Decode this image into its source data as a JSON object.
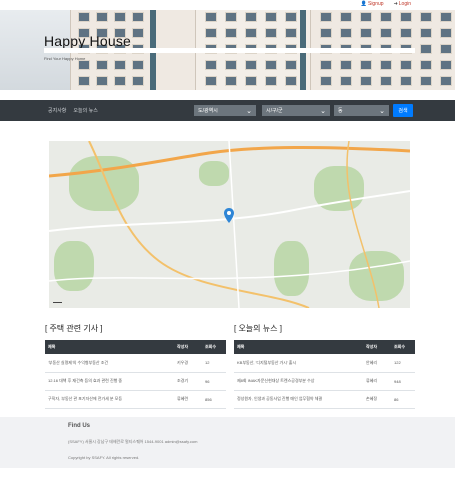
{
  "top_links": {
    "signup": "Signup",
    "login": "Login"
  },
  "hero": {
    "title": "Happy House",
    "subtitle": "Find Your Happy Home"
  },
  "nav": {
    "links": [
      "공지사항",
      "오늘의 뉴스"
    ],
    "selects": [
      "도/광역시",
      "시/구/군",
      "동"
    ],
    "search_label": "검색"
  },
  "news_left": {
    "heading": "[ 주택 관련 기사 ]",
    "columns": [
      "제목",
      "작성자",
      "조회수"
    ],
    "rows": [
      [
        "'부동산 실명제'의 수익형부동산 조건",
        "키우경",
        "12"
      ],
      [
        "12.16 대책 후 재건축 등의 효과 관련 진행 중",
        "조경기",
        "96"
      ],
      [
        "구직자, 부동산 관 포기자산에 전가세 분 모등",
        "류혜련",
        "856"
      ]
    ]
  },
  "news_right": {
    "heading": "[ 오늘의 뉴스 ]",
    "columns": [
      "제목",
      "작성자",
      "조회수"
    ],
    "rows": [
      [
        "KB부동산, '디지털부동산 가시' 출시",
        "안혜리",
        "122"
      ],
      [
        "제8회 INAK자문신현대상 트렌스공경부분 수상",
        "류혜리",
        "948"
      ],
      [
        "정성원자, 인생과 공동사업 진행 매인 업무협약 체결",
        "손혜정",
        "86"
      ]
    ]
  },
  "footer": {
    "heading": "Find Us",
    "address": "(SSAFY) 서울시 강남구 테헤란로 멀티스퀘어   1544-9001   admin@ssafy.com",
    "copyright": "Copyright by SSAFY. All rights reserved."
  },
  "colors": {
    "nav_bg": "#343a40",
    "accent": "#007bff",
    "select_bg": "#6c757d",
    "link": "#c0392b"
  }
}
